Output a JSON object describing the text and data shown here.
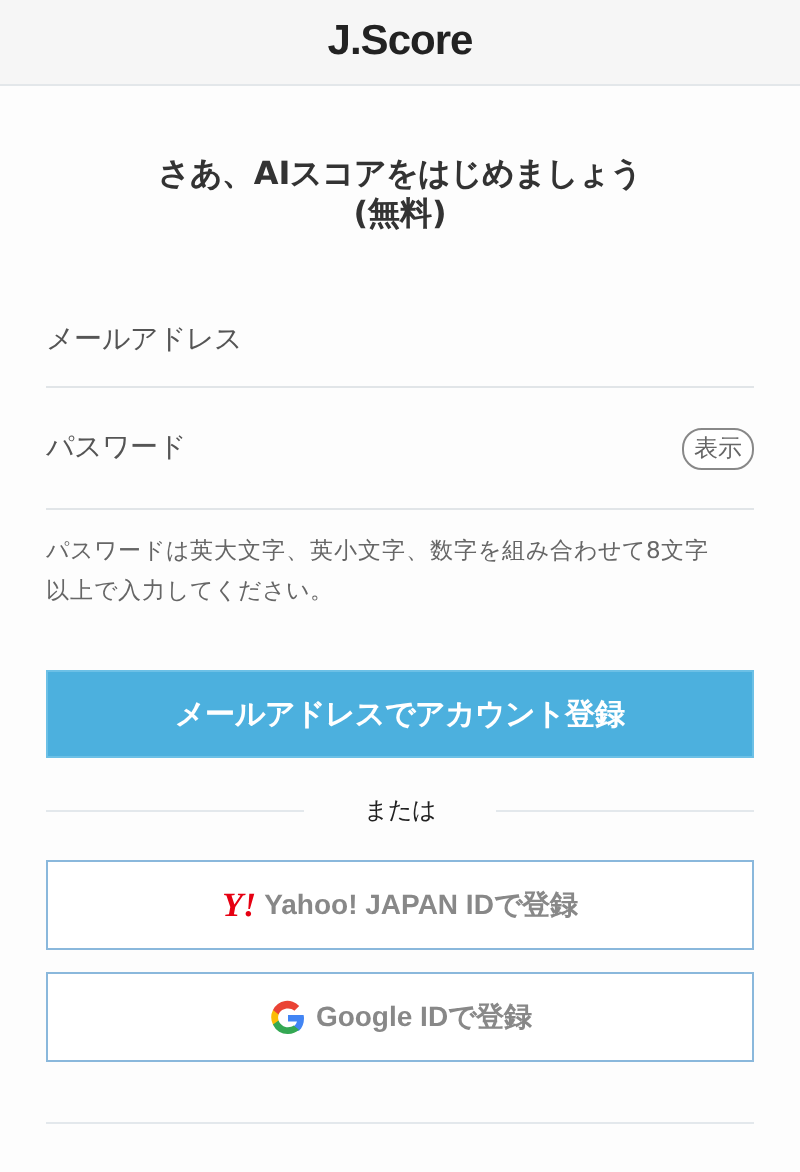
{
  "header": {
    "logo": "J.Score"
  },
  "title": {
    "line1": "さあ、AIスコアをはじめましょう",
    "line2": "(無料)"
  },
  "fields": [
    {
      "placeholder": "メールアドレス"
    },
    {
      "placeholder": "パスワード",
      "toggle": "表示"
    }
  ],
  "hint": "パスワードは英大文字、英小文字、数字を組み合わせて8文字以上で入力してください。",
  "primary_button": "メールアドレスでアカウント登録",
  "divider_text": "または",
  "social_buttons": [
    {
      "kind": "yahoo",
      "logo": "Y!",
      "label": "Yahoo! JAPAN IDで登録"
    },
    {
      "kind": "google",
      "label": "Google IDで登録"
    }
  ]
}
